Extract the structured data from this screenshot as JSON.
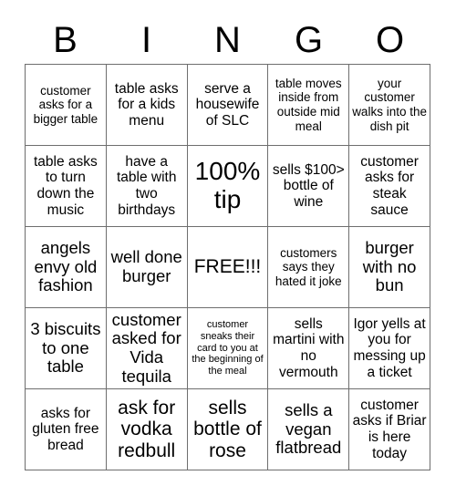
{
  "card": {
    "header_letters": [
      "B",
      "I",
      "N",
      "G",
      "O"
    ],
    "columns": 5,
    "rows": 5,
    "border_color": "#6e6e6e",
    "text_color": "#000000",
    "background_color": "#ffffff",
    "cells": [
      {
        "text": "customer asks for a bigger table",
        "size": "sm",
        "free": false
      },
      {
        "text": "table asks for a kids menu",
        "size": "md",
        "free": false
      },
      {
        "text": "serve a housewife of SLC",
        "size": "md",
        "free": false
      },
      {
        "text": "table moves inside from outside mid meal",
        "size": "sm",
        "free": false
      },
      {
        "text": "your customer walks into the dish pit",
        "size": "sm",
        "free": false
      },
      {
        "text": "table asks to turn down the music",
        "size": "md",
        "free": false
      },
      {
        "text": "have a table with two birthdays",
        "size": "md",
        "free": false
      },
      {
        "text": "100% tip",
        "size": "xxl",
        "free": false
      },
      {
        "text": "sells $100> bottle of wine",
        "size": "md",
        "free": false
      },
      {
        "text": "customer asks for steak sauce",
        "size": "md",
        "free": false
      },
      {
        "text": "angels envy old fashion",
        "size": "lg",
        "free": false
      },
      {
        "text": "well done burger",
        "size": "lg",
        "free": false
      },
      {
        "text": "FREE!!!",
        "size": "xl",
        "free": true
      },
      {
        "text": "customers says they hated it joke",
        "size": "sm",
        "free": false
      },
      {
        "text": "burger with no bun",
        "size": "lg",
        "free": false
      },
      {
        "text": "3 biscuits to one table",
        "size": "lg",
        "free": false
      },
      {
        "text": "customer asked for Vida tequila",
        "size": "lg",
        "free": false
      },
      {
        "text": "customer sneaks their card to you at the beginning of the meal",
        "size": "xs",
        "free": false
      },
      {
        "text": "sells martini with no vermouth",
        "size": "md",
        "free": false
      },
      {
        "text": "Igor yells at you for messing up a ticket",
        "size": "md",
        "free": false
      },
      {
        "text": "asks for gluten free bread",
        "size": "md",
        "free": false
      },
      {
        "text": "ask for vodka redbull",
        "size": "xl",
        "free": false
      },
      {
        "text": "sells bottle of rose",
        "size": "xl",
        "free": false
      },
      {
        "text": "sells a vegan flatbread",
        "size": "lg",
        "free": false
      },
      {
        "text": "customer asks if Briar is here today",
        "size": "md",
        "free": false
      }
    ]
  }
}
